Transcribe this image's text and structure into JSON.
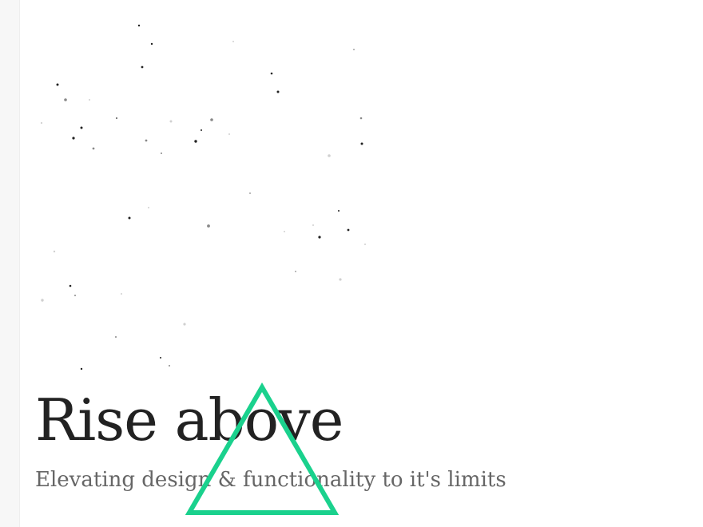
{
  "hero": {
    "title": "Rise above",
    "subtitle": "Elevating design & functionality to it's limits"
  },
  "colors": {
    "accent": "#1ad18d",
    "title": "#222222",
    "subtitle": "#666666",
    "background": "#ffffff"
  },
  "icons": {
    "logo": "triangle-outline-icon"
  }
}
